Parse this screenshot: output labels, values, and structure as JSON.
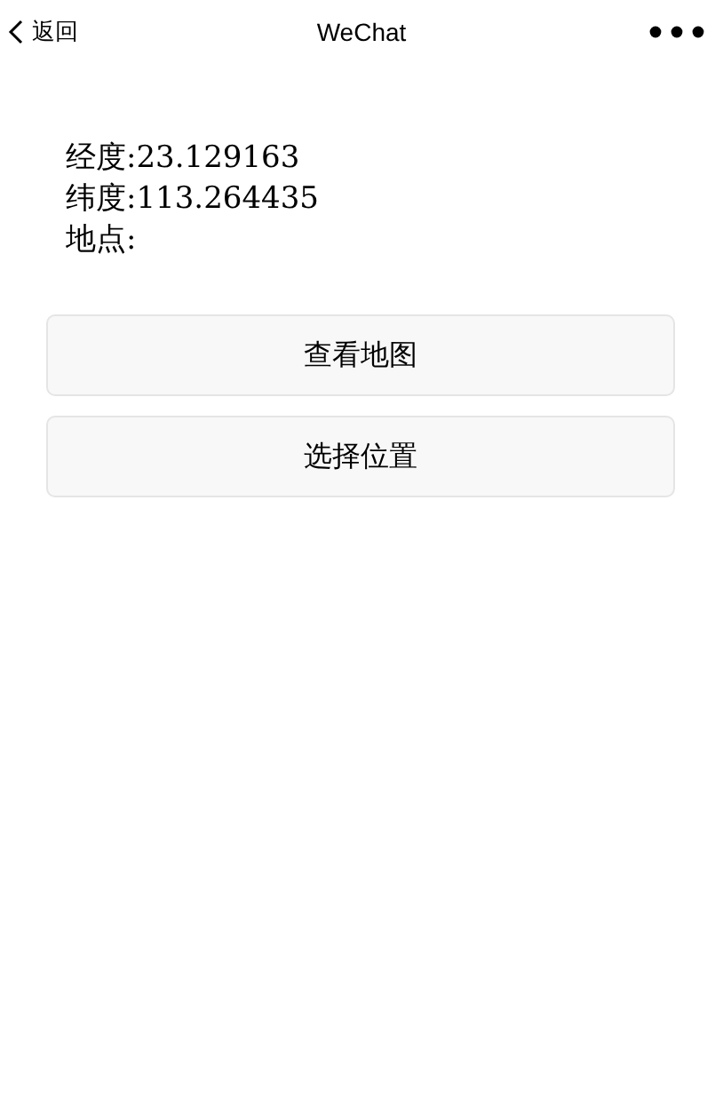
{
  "nav_bar": {
    "back": "返回",
    "title": "WeChat"
  },
  "info_lines": [
    "经度:23.129163",
    "纬度:113.264435",
    "地点:"
  ],
  "buttons": [
    "查看地图",
    "选择位置"
  ]
}
